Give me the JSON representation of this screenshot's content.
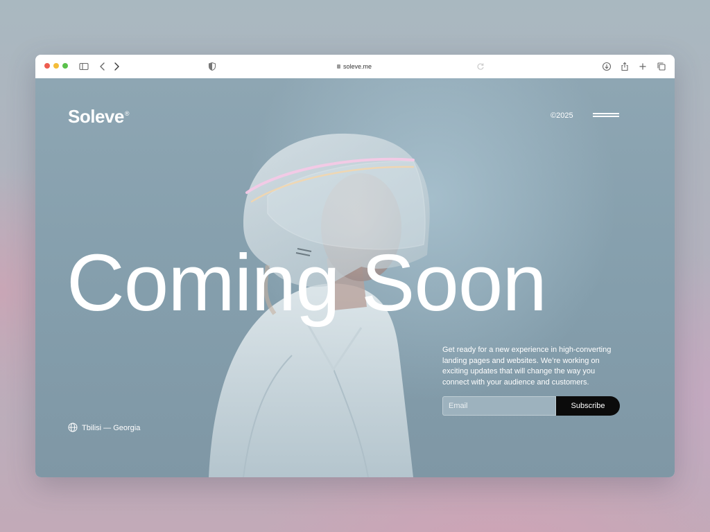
{
  "browser": {
    "url": "soleve.me",
    "icons": [
      "sidebar-icon",
      "back-icon",
      "forward-icon",
      "shield-icon",
      "reload-icon",
      "download-icon",
      "share-icon",
      "new-tab-icon",
      "tabs-overview-icon"
    ]
  },
  "header": {
    "brand": "Soleve",
    "brand_mark": "®",
    "year": "©2025",
    "menu_icon": "menu-icon"
  },
  "hero": {
    "headline": "Coming Soon",
    "description": "Get ready for a new experience in high-converting landing pages and websites. We’re working on exciting updates that will change the way you connect with your audience and customers."
  },
  "subscribe": {
    "email_placeholder": "Email",
    "button_label": "Subscribe"
  },
  "footer": {
    "location": "Tbilisi — Georgia",
    "location_icon": "globe-icon"
  },
  "colors": {
    "page_background": "#849eac",
    "button_background": "#0b0b0b",
    "text": "#ffffff"
  }
}
